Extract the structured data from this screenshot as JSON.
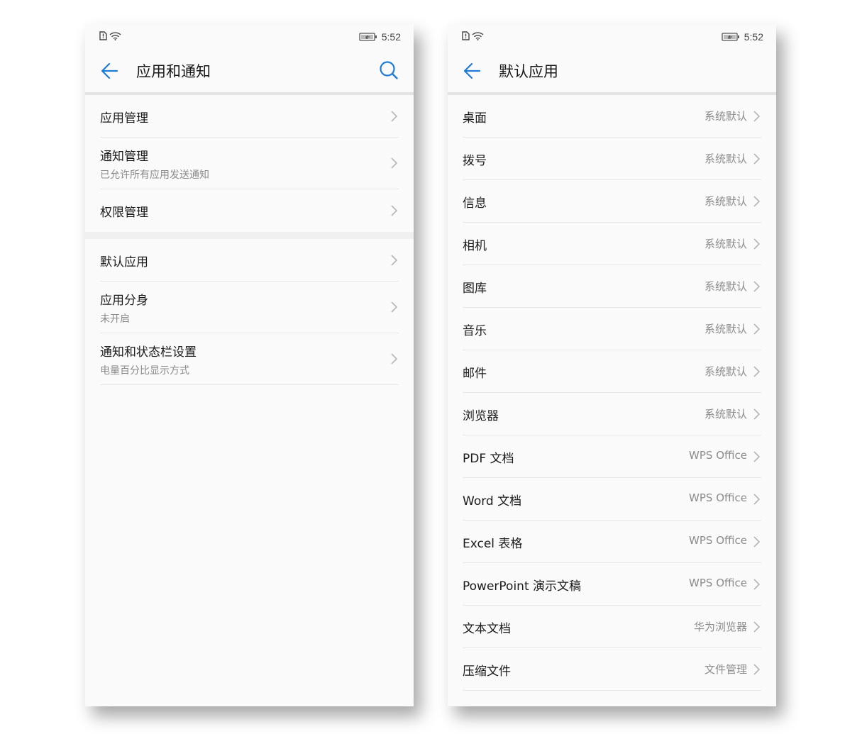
{
  "left_screen": {
    "status": {
      "time": "5:52"
    },
    "title": "应用和通知",
    "group1": [
      {
        "title": "应用管理",
        "subtitle": ""
      },
      {
        "title": "通知管理",
        "subtitle": "已允许所有应用发送通知"
      },
      {
        "title": "权限管理",
        "subtitle": ""
      }
    ],
    "group2": [
      {
        "title": "默认应用",
        "subtitle": ""
      },
      {
        "title": "应用分身",
        "subtitle": "未开启"
      },
      {
        "title": "通知和状态栏设置",
        "subtitle": "电量百分比显示方式"
      }
    ]
  },
  "right_screen": {
    "status": {
      "time": "5:52"
    },
    "title": "默认应用",
    "items": [
      {
        "title": "桌面",
        "value": "系统默认"
      },
      {
        "title": "拨号",
        "value": "系统默认"
      },
      {
        "title": "信息",
        "value": "系统默认"
      },
      {
        "title": "相机",
        "value": "系统默认"
      },
      {
        "title": "图库",
        "value": "系统默认"
      },
      {
        "title": "音乐",
        "value": "系统默认"
      },
      {
        "title": "邮件",
        "value": "系统默认"
      },
      {
        "title": "浏览器",
        "value": "系统默认"
      },
      {
        "title": "PDF 文档",
        "value": "WPS Office"
      },
      {
        "title": "Word 文档",
        "value": "WPS Office"
      },
      {
        "title": "Excel 表格",
        "value": "WPS Office"
      },
      {
        "title": "PowerPoint 演示文稿",
        "value": "WPS Office"
      },
      {
        "title": "文本文档",
        "value": "华为浏览器"
      },
      {
        "title": "压缩文件",
        "value": "文件管理"
      }
    ]
  },
  "colors": {
    "accent": "#1e7bd6",
    "chevron": "#b5b5b5",
    "background": "#fafafa"
  }
}
